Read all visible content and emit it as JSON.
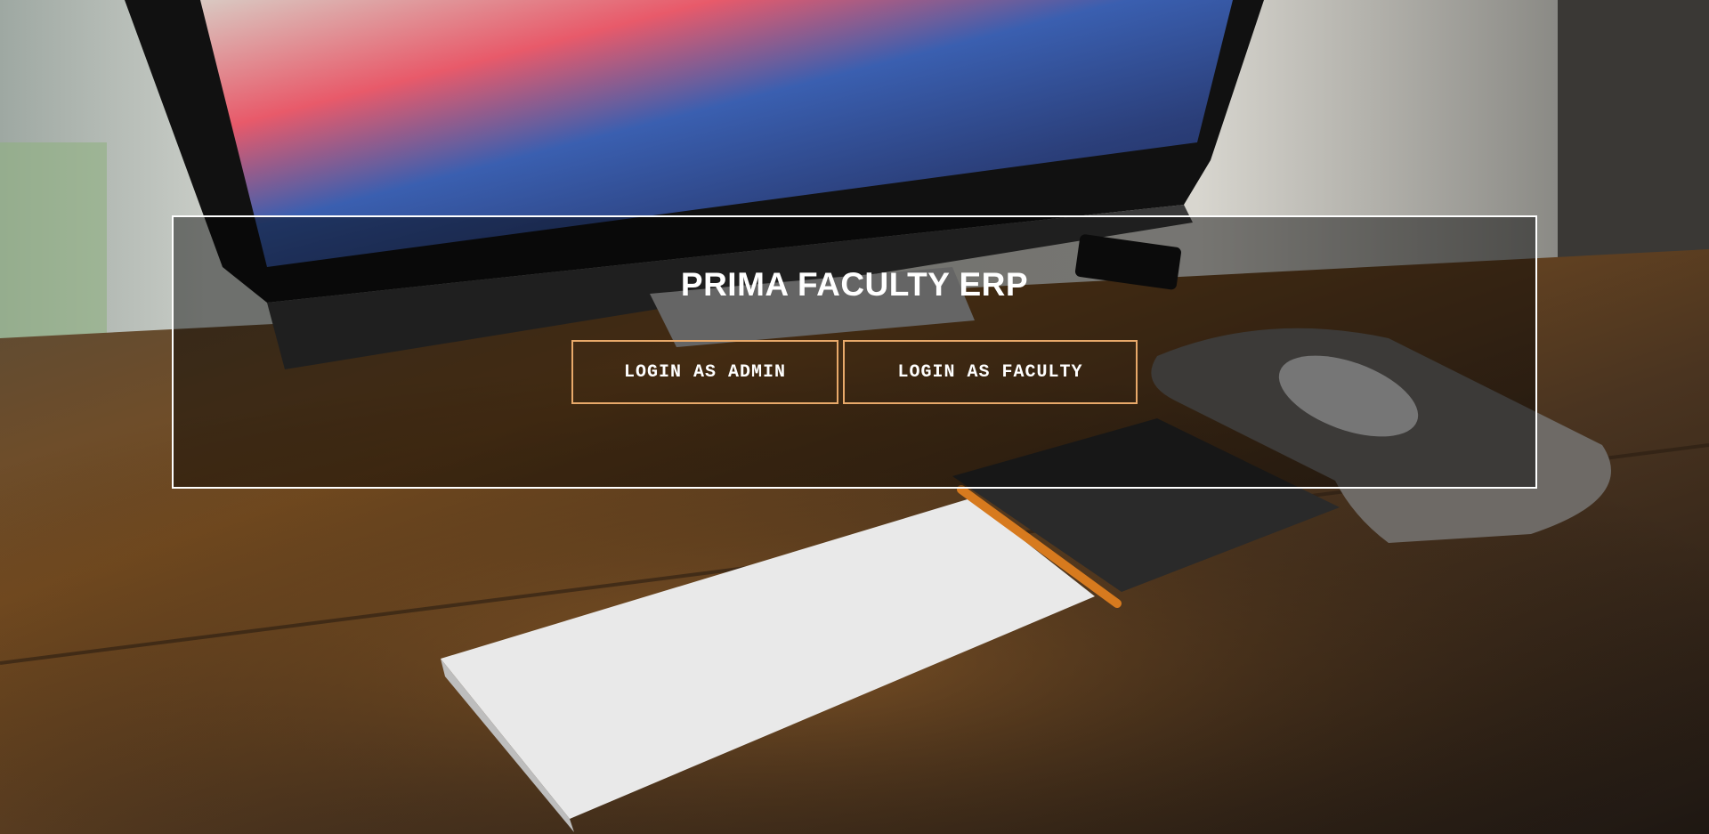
{
  "app": {
    "title": "PRIMA FACULTY ERP"
  },
  "actions": {
    "admin_label": "LOGIN AS ADMIN",
    "faculty_label": "LOGIN AS FACULTY"
  },
  "colors": {
    "overlay_border": "#ffffff",
    "button_border": "#e8a96a",
    "text": "#ffffff"
  }
}
